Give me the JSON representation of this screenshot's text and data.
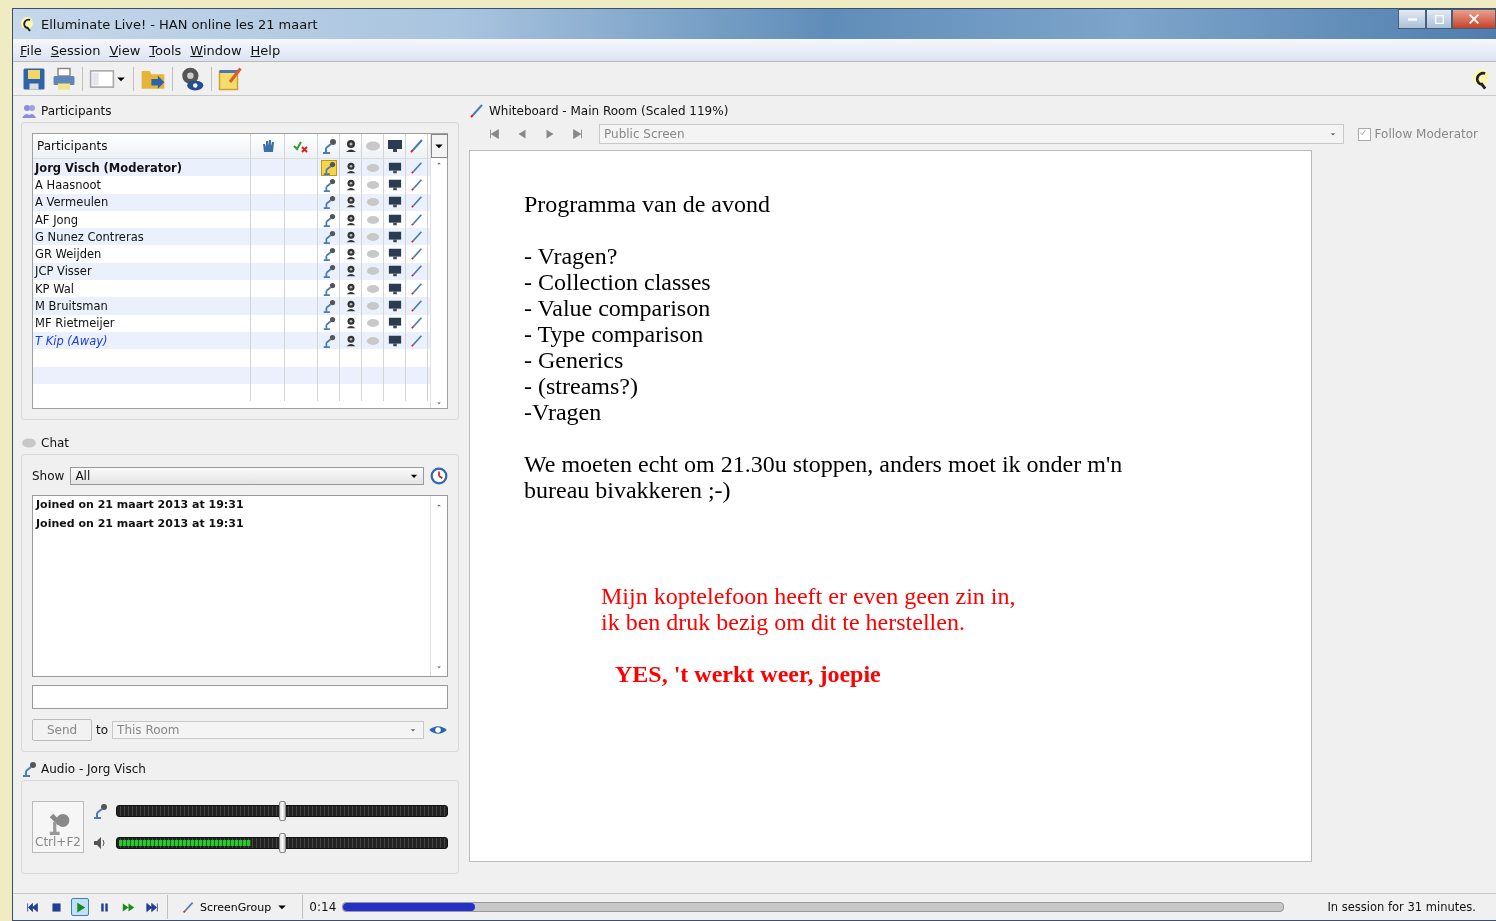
{
  "window": {
    "title": "Elluminate Live! - HAN online les 21 maart"
  },
  "menu": [
    "File",
    "Session",
    "View",
    "Tools",
    "Window",
    "Help"
  ],
  "participants": {
    "title": "Participants",
    "column_header": "Participants",
    "rows": [
      {
        "name": "Jorg Visch (Moderator)",
        "moderator": true,
        "away": false,
        "mic_active": true
      },
      {
        "name": "A Haasnoot",
        "moderator": false,
        "away": false,
        "mic_active": false
      },
      {
        "name": "A Vermeulen",
        "moderator": false,
        "away": false,
        "mic_active": false
      },
      {
        "name": "AF Jong",
        "moderator": false,
        "away": false,
        "mic_active": false
      },
      {
        "name": "G Nunez Contreras",
        "moderator": false,
        "away": false,
        "mic_active": false
      },
      {
        "name": "GR Weijden",
        "moderator": false,
        "away": false,
        "mic_active": false
      },
      {
        "name": "JCP Visser",
        "moderator": false,
        "away": false,
        "mic_active": false
      },
      {
        "name": "KP Wal",
        "moderator": false,
        "away": false,
        "mic_active": false
      },
      {
        "name": "M Bruitsman",
        "moderator": false,
        "away": false,
        "mic_active": false
      },
      {
        "name": "MF Rietmeijer",
        "moderator": false,
        "away": false,
        "mic_active": false
      },
      {
        "name": "T Kip (Away)",
        "moderator": false,
        "away": true,
        "mic_active": false
      }
    ]
  },
  "chat": {
    "title": "Chat",
    "show_label": "Show",
    "filter": "All",
    "messages": [
      "Joined on 21 maart 2013 at 19:31",
      "Joined on 21 maart 2013 at 19:31"
    ],
    "send": {
      "label": "Send",
      "disabled": true
    },
    "to_label": "to",
    "recipient": "This Room"
  },
  "audio": {
    "title": "Audio - Jorg Visch",
    "talk_button": "Ctrl+F2",
    "mic_volume": {
      "level": 0.5
    },
    "speaker_volume": {
      "level": 0.5
    },
    "speaker_meter": {
      "level": 0.4
    }
  },
  "whiteboard": {
    "title": "Whiteboard - Main Room (Scaled 119%)",
    "screen": "Public Screen",
    "follow_moderator": {
      "label": "Follow Moderator",
      "checked": true
    },
    "blocks": [
      {
        "kind": "normal",
        "lines": [
          "Programma van de avond"
        ]
      },
      {
        "kind": "normal",
        "lines": [
          "- Vragen?",
          "- Collection classes",
          "- Value comparison",
          "- Type comparison",
          "- Generics",
          "- (streams?)",
          "-Vragen"
        ]
      },
      {
        "kind": "normal",
        "lines": [
          "We moeten echt om 21.30u stoppen, anders moet ik onder m'n",
          "bureau bivakkeren ;-)"
        ]
      },
      {
        "kind": "red",
        "lines": [
          "Mijn koptelefoon heeft er even geen zin in,",
          "ik ben druk bezig om dit te herstellen."
        ]
      },
      {
        "kind": "red_bold",
        "lines": [
          "YES, 't werkt weer, joepie"
        ]
      }
    ]
  },
  "playback": {
    "buttons": [
      {
        "kind": "first",
        "selected": false
      },
      {
        "kind": "stop",
        "selected": false
      },
      {
        "kind": "play",
        "selected": true
      },
      {
        "kind": "pause",
        "selected": false
      },
      {
        "kind": "forward",
        "selected": false
      },
      {
        "kind": "last",
        "selected": false
      }
    ],
    "group": "ScreenGroup",
    "time": "0:14",
    "progress": {
      "level": 0.14
    },
    "status": "In session for 31 minutes."
  }
}
